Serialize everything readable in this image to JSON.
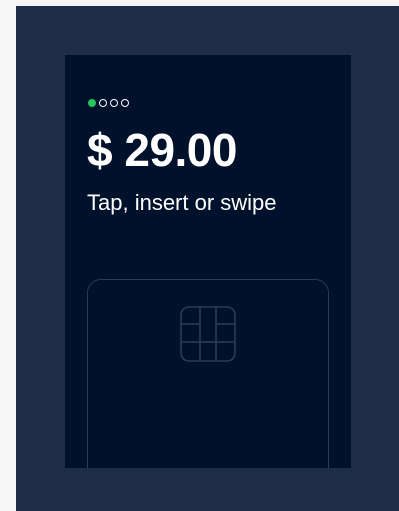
{
  "payment": {
    "amount": "$ 29.00",
    "instruction": "Tap, insert or swipe",
    "steps": {
      "total": 4,
      "current": 1
    },
    "icons": {
      "card": "card-outline",
      "chip": "emv-chip-icon"
    },
    "colors": {
      "page_background": "#f6f6f6",
      "frame": "#1f2c47",
      "screen": "#00112b",
      "step_active": "#22c55e",
      "text": "#ffffff",
      "outline": "#2c3b57"
    }
  }
}
